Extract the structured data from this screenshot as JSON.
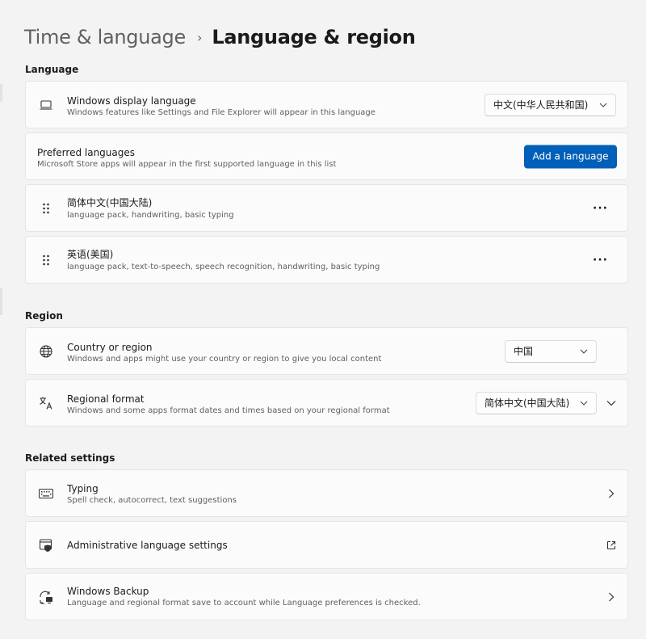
{
  "breadcrumb": {
    "parent": "Time & language",
    "separator": "›",
    "current": "Language & region"
  },
  "sections": {
    "language": "Language",
    "region": "Region",
    "related": "Related settings"
  },
  "display_language": {
    "icon": "laptop-icon",
    "title": "Windows display language",
    "description": "Windows features like Settings and File Explorer will appear in this language",
    "value": "中文(中华人民共和国)"
  },
  "preferred": {
    "title": "Preferred languages",
    "description": "Microsoft Store apps will appear in the first supported language in this list",
    "button": "Add a language"
  },
  "languages": [
    {
      "name": "简体中文(中国大陆)",
      "features": "language pack, handwriting, basic typing",
      "more": "···"
    },
    {
      "name": "英语(美国)",
      "features": "language pack, text-to-speech, speech recognition, handwriting, basic typing",
      "more": "···"
    }
  ],
  "country": {
    "icon": "globe-icon",
    "title": "Country or region",
    "description": "Windows and apps might use your country or region to give you local content",
    "value": "中国"
  },
  "regional_format": {
    "icon": "regional-format-icon",
    "title": "Regional format",
    "description": "Windows and some apps format dates and times based on your regional format",
    "value": "简体中文(中国大陆)"
  },
  "typing": {
    "icon": "keyboard-icon",
    "title": "Typing",
    "description": "Spell check, autocorrect, text suggestions"
  },
  "admin": {
    "icon": "admin-shield-icon",
    "title": "Administrative language settings"
  },
  "backup": {
    "icon": "backup-icon",
    "title": "Windows Backup",
    "description": "Language and regional format save to account while Language preferences is checked."
  },
  "colors": {
    "accent": "#005fb8",
    "background": "#f3f3f3",
    "card": "#fbfbfb"
  }
}
